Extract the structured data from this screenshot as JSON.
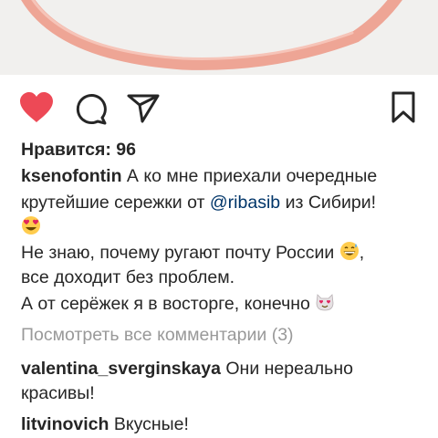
{
  "post": {
    "likes_text": "Нравится: 96",
    "author": "ksenofontin",
    "caption_line1": "А ко мне приехали очередные",
    "caption_line2_pre": "крутейшие сережки от",
    "caption_mention": "@ribasib",
    "caption_line2_post": "из Сибири!",
    "caption_line4": "Не знаю, почему ругают почту России",
    "caption_line5": "все доходит без проблем.",
    "caption_line6": "А от серёжек я в восторге, конечно",
    "view_all_comments": "Посмотреть все комментарии (3)",
    "emojis": [
      "heart-eyes-emoji",
      "grinning-sweat-emoji",
      "heart-eyes-cat-emoji"
    ]
  },
  "comments": [
    {
      "user": "valentina_sverginskaya",
      "text_line1": "Они нереально",
      "text_line2": "красивы!"
    },
    {
      "user": "litvinovich",
      "text_line1": "Вкусные!"
    }
  ],
  "icons": {
    "like": "heart-icon",
    "comment": "comment-icon",
    "share": "send-icon",
    "save": "bookmark-icon"
  },
  "colors": {
    "like_active": "#ed4956",
    "mention": "#003569",
    "muted": "#999999",
    "text": "#262626"
  }
}
